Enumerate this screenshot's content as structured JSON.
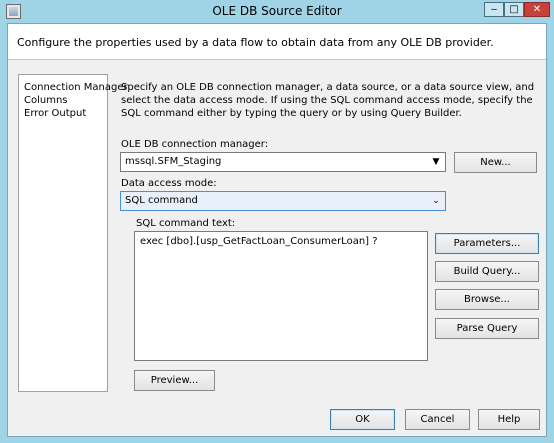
{
  "window": {
    "title": "OLE DB Source Editor",
    "controls": {
      "minimize": "‒",
      "maximize": "□",
      "close": "✕"
    }
  },
  "banner": {
    "text": "Configure the properties used by a data flow to obtain data from any OLE DB provider."
  },
  "nav": {
    "items": [
      {
        "label": "Connection Manager"
      },
      {
        "label": "Columns"
      },
      {
        "label": "Error Output"
      }
    ]
  },
  "main": {
    "description": "Specify an OLE DB connection manager, a data source, or a data source view, and select the data access mode. If using the SQL command access mode, specify the SQL command either by typing the query or by using Query Builder.",
    "connection_manager_label": "OLE DB connection manager:",
    "connection_manager_value": "mssql.SFM_Staging",
    "new_button": "New...",
    "access_mode_label": "Data access mode:",
    "access_mode_value": "SQL command",
    "sql_label": "SQL command text:",
    "sql_text": "exec [dbo].[usp_GetFactLoan_ConsumerLoan] ?",
    "parameters_button": "Parameters...",
    "build_query_button": "Build Query...",
    "browse_button": "Browse...",
    "parse_query_button": "Parse Query",
    "preview_button": "Preview..."
  },
  "footer": {
    "ok": "OK",
    "cancel": "Cancel",
    "help": "Help"
  }
}
